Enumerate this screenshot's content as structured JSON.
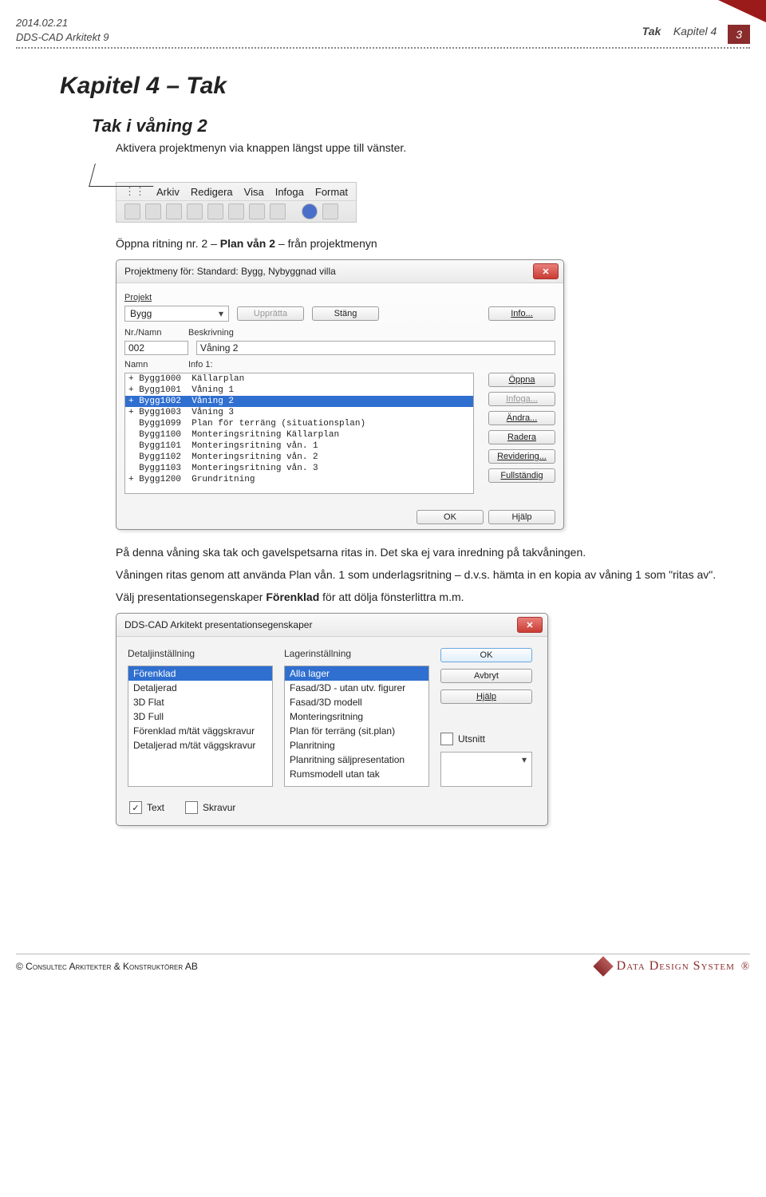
{
  "header": {
    "date": "2014.02.21",
    "product": "DDS-CAD Arkitekt 9",
    "section": "Tak",
    "chapter_label": "Kapitel 4",
    "page_number": "3"
  },
  "headings": {
    "chapter": "Kapitel 4 – Tak",
    "subchapter": "Tak i våning 2"
  },
  "paragraphs": {
    "intro": "Aktivera projektmenyn via knappen längst uppe till vänster.",
    "open_drawing": "Öppna ritning nr. 2 – Plan vån 2 – från projektmenyn",
    "after_dialog": "På denna våning ska tak och gavelspetsarna ritas in. Det ska ej vara inredning på takvåningen.",
    "copy_note": "Våningen ritas genom att använda Plan vån. 1 som underlagsritning – d.v.s. hämta in en kopia av våning 1 som \"ritas av\".",
    "pres_note": "Välj presentationsegenskaper Förenklad för att dölja fönsterlittra m.m."
  },
  "menubar": {
    "items": [
      "Arkiv",
      "Redigera",
      "Visa",
      "Infoga",
      "Format"
    ]
  },
  "project_dialog": {
    "title": "Projektmeny för: Standard: Bygg, Nybyggnad villa",
    "lbl_projekt": "Projekt",
    "project_value": "Bygg",
    "btn_uppratta": "Upprätta",
    "btn_stang": "Stäng",
    "btn_info": "Info...",
    "lbl_nr": "Nr./Namn",
    "lbl_beskr": "Beskrivning",
    "nr_value": "002",
    "beskr_value": "Våning 2",
    "lbl_namn": "Namn",
    "lbl_info1": "Info 1:",
    "rows": [
      {
        "text": "+ Bygg1000  Källarplan"
      },
      {
        "text": "+ Bygg1001  Våning 1"
      },
      {
        "text": "+ Bygg1002  Våning 2",
        "selected": true
      },
      {
        "text": "+ Bygg1003  Våning 3"
      },
      {
        "text": "  Bygg1099  Plan för terräng (situationsplan)"
      },
      {
        "text": "  Bygg1100  Monteringsritning Källarplan"
      },
      {
        "text": "  Bygg1101  Monteringsritning vån. 1"
      },
      {
        "text": "  Bygg1102  Monteringsritning vån. 2"
      },
      {
        "text": "  Bygg1103  Monteringsritning vån. 3"
      },
      {
        "text": "+ Bygg1200  Grundritning"
      }
    ],
    "side_buttons": {
      "oppna": "Öppna",
      "infoga": "Infoga...",
      "andra": "Ändra...",
      "radera": "Radera",
      "revidering": "Revidering...",
      "fullstandig": "Fullständig"
    },
    "btn_ok": "OK",
    "btn_hjalp": "Hjälp"
  },
  "pres_dialog": {
    "title": "DDS-CAD Arkitekt presentationsegenskaper",
    "col1_label": "Detaljinställning",
    "col2_label": "Lagerinställning",
    "col1_items": [
      {
        "text": "Förenklad",
        "selected": true
      },
      {
        "text": "Detaljerad"
      },
      {
        "text": "3D Flat"
      },
      {
        "text": "3D Full"
      },
      {
        "text": "Förenklad m/tät väggskravur"
      },
      {
        "text": "Detaljerad m/tät väggskravur"
      }
    ],
    "col2_items": [
      {
        "text": "Alla lager",
        "selected": true
      },
      {
        "text": "Fasad/3D - utan utv. figurer"
      },
      {
        "text": "Fasad/3D modell"
      },
      {
        "text": "Monteringsritning"
      },
      {
        "text": "Plan för terräng (sit.plan)"
      },
      {
        "text": "Planritning"
      },
      {
        "text": "Planritning säljpresentation"
      },
      {
        "text": "Rumsmodell utan tak"
      }
    ],
    "btn_ok": "OK",
    "btn_avbryt": "Avbryt",
    "btn_hjalp": "Hjälp",
    "chk_utsnitt": "Utsnitt",
    "chk_text": "Text",
    "chk_skravur": "Skravur"
  },
  "footer": {
    "left": "©   Consultec Arkitekter & Konstruktörer AB",
    "brand": "Data Design System"
  }
}
